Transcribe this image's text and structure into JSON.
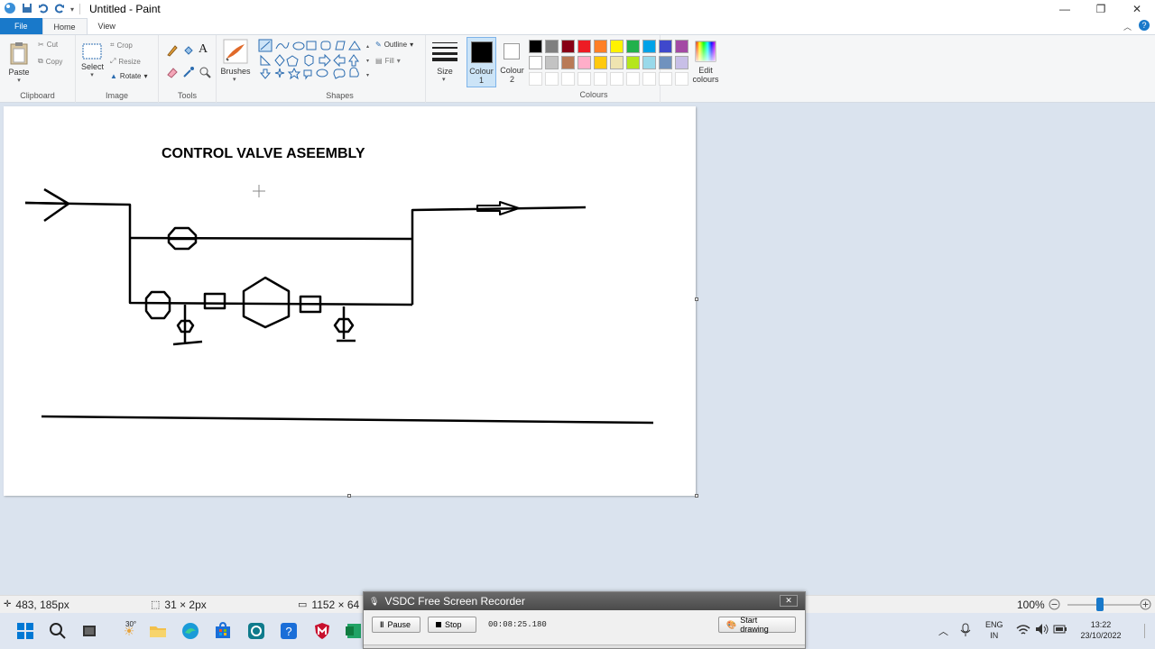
{
  "window": {
    "title": "Untitled - Paint"
  },
  "tabs": [
    {
      "label": "File"
    },
    {
      "label": "Home"
    },
    {
      "label": "View"
    }
  ],
  "ribbon": {
    "clipboard": {
      "paste": "Paste",
      "cut": "Cut",
      "copy": "Copy",
      "group": "Clipboard"
    },
    "image": {
      "select": "Select",
      "crop": "Crop",
      "resize": "Resize",
      "rotate": "Rotate",
      "group": "Image"
    },
    "tools": {
      "group": "Tools",
      "text_tool": "A"
    },
    "brushes": {
      "label": "Brushes"
    },
    "shapes": {
      "outline": "Outline",
      "fill": "Fill",
      "group": "Shapes"
    },
    "size": {
      "label": "Size"
    },
    "colour1": {
      "label": "Colour",
      "sub": "1",
      "color": "#000000"
    },
    "colour2": {
      "label": "Colour",
      "sub": "2",
      "color": "#ffffff"
    },
    "colours": {
      "group": "Colours",
      "row1": [
        "#000000",
        "#7f7f7f",
        "#880015",
        "#ed1c24",
        "#ff7f27",
        "#fff200",
        "#22b14c",
        "#00a2e8",
        "#3f48cc",
        "#a349a4"
      ],
      "row2": [
        "#ffffff",
        "#c3c3c3",
        "#b97a57",
        "#ffaec9",
        "#ffc90e",
        "#efe4b0",
        "#b5e61d",
        "#99d9ea",
        "#7092be",
        "#c8bfe7"
      ]
    },
    "edit_colours": {
      "line1": "Edit",
      "line2": "colours"
    }
  },
  "canvas": {
    "title": "CONTROL VALVE ASEEMBLY"
  },
  "statusbar": {
    "cursor_pos": "483, 185px",
    "selection_size": "31 × 2px",
    "image_size": "1152 × 64",
    "zoom": "100%"
  },
  "recorder": {
    "title": "VSDC Free Screen Recorder",
    "pause": "Pause",
    "stop": "Stop",
    "time": "00:08:25.180",
    "start_drawing": "Start drawing"
  },
  "taskbar": {
    "weather": "30°",
    "lang1": "ENG",
    "lang2": "IN",
    "time": "13:22",
    "date": "23/10/2022"
  }
}
